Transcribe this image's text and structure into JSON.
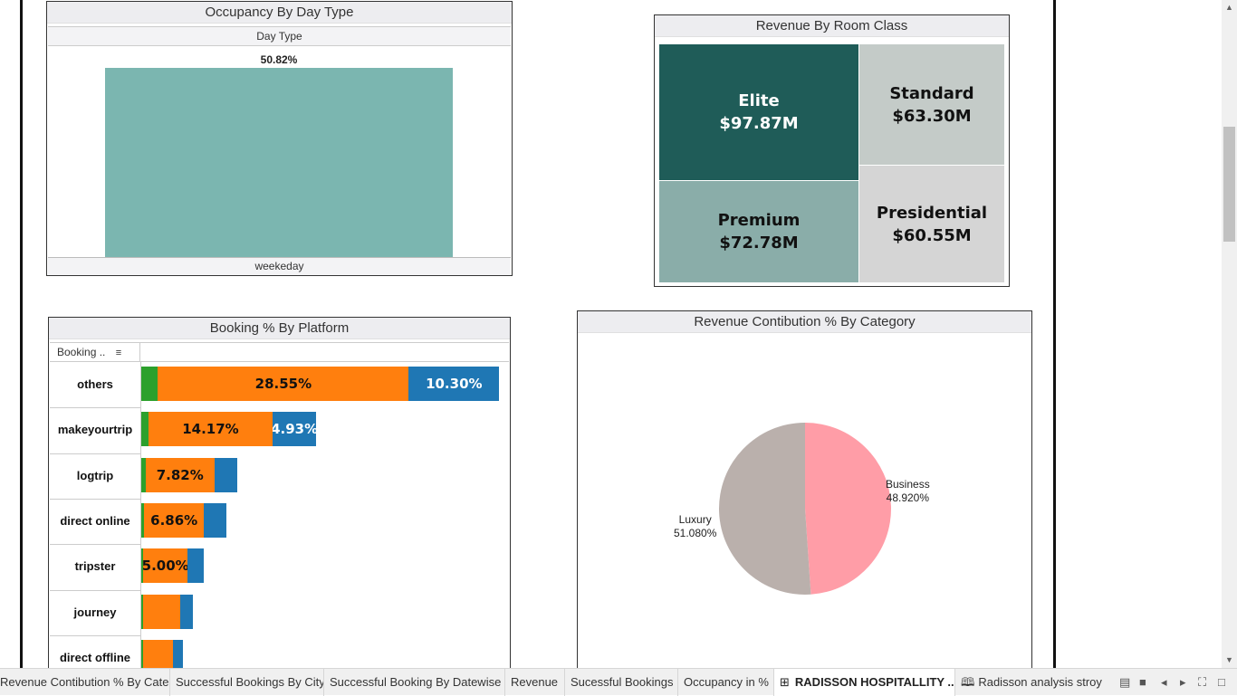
{
  "occupancy": {
    "title": "Occupancy By Day Type",
    "sub_header": "Day Type",
    "bar_label": "50.82%",
    "bar_value_pct": 50.82,
    "category": "weekeday",
    "bar_color": "#7bb6b0"
  },
  "room_class": {
    "title": "Revenue By Room Class",
    "tiles": [
      {
        "name": "Elite",
        "value": "$97.87M",
        "color": "#1f5c58",
        "text_color": "#ffffff"
      },
      {
        "name": "Standard",
        "value": "$63.30M",
        "color": "#c4cbc8",
        "text_color": "#111111"
      },
      {
        "name": "Premium",
        "value": "$72.78M",
        "color": "#8aada9",
        "text_color": "#111111"
      },
      {
        "name": "Presidential",
        "value": "$60.55M",
        "color": "#d5d5d5",
        "text_color": "#111111"
      }
    ]
  },
  "platform": {
    "title": "Booking % By Platform",
    "column_header": "Booking ..",
    "colors": {
      "green": "#2ca02c",
      "orange": "#ff7f0e",
      "blue": "#1f77b4"
    },
    "rows": [
      {
        "label": "others",
        "green": 1.9,
        "orange": 28.55,
        "blue": 10.3,
        "orange_label": "28.55%",
        "blue_label": "10.30%"
      },
      {
        "label": "makeyourtrip",
        "green": 0.8,
        "orange": 14.17,
        "blue": 4.93,
        "orange_label": "14.17%",
        "blue_label": "4.93%"
      },
      {
        "label": "logtrip",
        "green": 0.5,
        "orange": 7.82,
        "blue": 2.6,
        "orange_label": "7.82%",
        "blue_label": ""
      },
      {
        "label": "direct online",
        "green": 0.3,
        "orange": 6.86,
        "blue": 2.5,
        "orange_label": "6.86%",
        "blue_label": ""
      },
      {
        "label": "tripster",
        "green": 0.25,
        "orange": 5.0,
        "blue": 1.9,
        "orange_label": "5.00%",
        "blue_label": ""
      },
      {
        "label": "journey",
        "green": 0.2,
        "orange": 4.2,
        "blue": 1.5,
        "orange_label": "",
        "blue_label": ""
      },
      {
        "label": "direct offline",
        "green": 0.2,
        "orange": 3.4,
        "blue": 1.1,
        "orange_label": "",
        "blue_label": ""
      }
    ]
  },
  "category": {
    "title": "Revenue Contibution % By Category",
    "chart_data": {
      "type": "pie",
      "slices": [
        {
          "name": "Business",
          "value": 48.92,
          "label": "48.920%",
          "color": "#ff9da7"
        },
        {
          "name": "Luxury",
          "value": 51.08,
          "label": "51.080%",
          "color": "#bab0ac"
        }
      ]
    }
  },
  "tabs": [
    {
      "label": "Revenue Contibution % By Cate...",
      "active": false
    },
    {
      "label": "Successful Bookings By City",
      "active": false
    },
    {
      "label": "Successful Booking By Datewise",
      "active": false
    },
    {
      "label": "Revenue",
      "active": false
    },
    {
      "label": "Sucessful Bookings",
      "active": false
    },
    {
      "label": "Occupancy in %",
      "active": false
    },
    {
      "label": "RADISSON HOSPITALLITY ...",
      "active": true
    },
    {
      "label": "Radisson analysis stroy",
      "active": false
    }
  ]
}
